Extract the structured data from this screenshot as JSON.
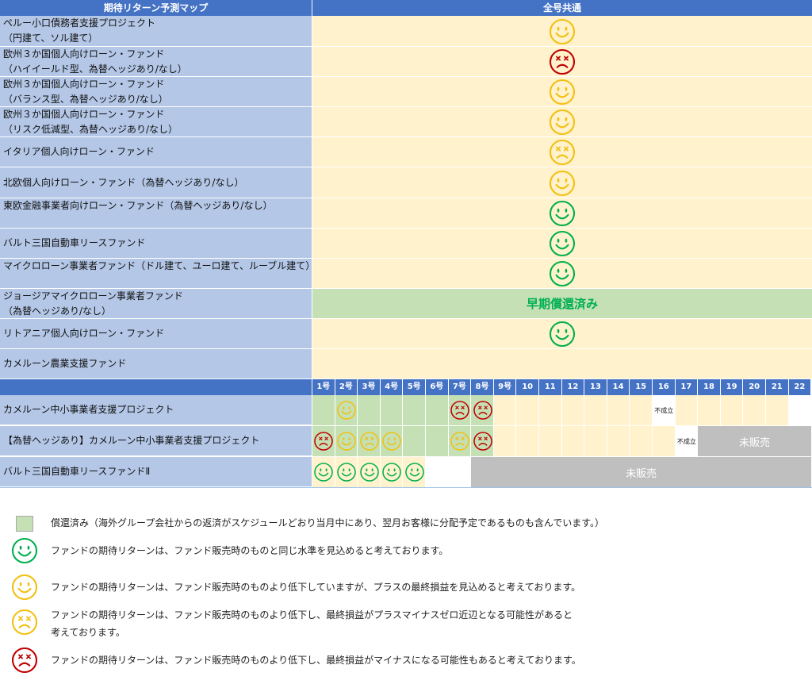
{
  "header": {
    "left": "期待リターン予測マップ",
    "right": "全号共通"
  },
  "funds": [
    {
      "name": "ペルー小口債務者支援プロジェクト\n（円建て、ソル建て）",
      "status": "yellow-smile"
    },
    {
      "name": "欧州３か国個人向けローン・ファンド\n（ハイイールド型、為替ヘッジあり/なし）",
      "status": "red-frown"
    },
    {
      "name": "欧州３か国個人向けローン・ファンド\n（バランス型、為替ヘッジあり/なし）",
      "status": "yellow-smile"
    },
    {
      "name": "欧州３か国個人向けローン・ファンド\n（リスク低減型、為替ヘッジあり/なし）",
      "status": "yellow-smile"
    },
    {
      "name": "イタリア個人向けローン・ファンド",
      "status": "yellow-frown"
    },
    {
      "name": "北欧個人向けローン・ファンド（為替ヘッジあり/なし）",
      "status": "yellow-smile"
    },
    {
      "name": "東欧金融事業者向けローン・ファンド（為替ヘッジあり/なし）",
      "status": "green-smile"
    },
    {
      "name": "バルト三国自動車リースファンド",
      "status": "green-smile"
    },
    {
      "name": "マイクロローン事業者ファンド（ドル建て、ユーロ建て、ルーブル建て）",
      "status": "green-smile"
    },
    {
      "name": "ジョージアマイクロローン事業者ファンド\n（為替ヘッジあり/なし）",
      "status": "redeemed",
      "label": "早期償還済み"
    },
    {
      "name": "リトアニア個人向けローン・ファンド",
      "status": "green-smile"
    },
    {
      "name": "カメルーン農業支援ファンド",
      "status": "blank"
    }
  ],
  "issue_numbers": [
    "1号",
    "2号",
    "3号",
    "4号",
    "5号",
    "6号",
    "7号",
    "8号",
    "9号",
    "10",
    "11",
    "12",
    "13",
    "14",
    "15",
    "16",
    "17",
    "18",
    "19",
    "20",
    "21",
    "22"
  ],
  "series_funds": [
    {
      "name": "カメルーン中小事業者支援プロジェクト",
      "cells": [
        "G",
        "YS",
        "G",
        "G",
        "G",
        "G",
        "RF",
        "RF",
        "C",
        "C",
        "C",
        "C",
        "C",
        "C",
        "C",
        "NOT",
        "C",
        "C",
        "C",
        "C",
        "C",
        "W"
      ]
    },
    {
      "name": "【為替ヘッジあり】カメルーン中小事業者支援プロジェクト",
      "cells": [
        "RF",
        "YS",
        "YF",
        "YS",
        "G",
        "G",
        "YF",
        "RF",
        "C",
        "C",
        "C",
        "C",
        "C",
        "C",
        "C",
        "C",
        "NOT",
        "U",
        "U",
        "U",
        "U",
        "U"
      ]
    },
    {
      "name": "バルト三国自動車リースファンドⅡ",
      "cells": [
        "GS",
        "GS",
        "GS",
        "GS",
        "GS",
        "W",
        "W",
        "U",
        "U",
        "U",
        "U",
        "U",
        "U",
        "U",
        "U",
        "U",
        "U",
        "U",
        "U",
        "U",
        "U",
        "U"
      ]
    }
  ],
  "not_established": "不成立",
  "unsold": "未販売",
  "legend": [
    {
      "icon": "redeemed-swatch",
      "text": "償還済み（海外グループ会社からの返済がスケジュールどおり当月中にあり、翌月お客様に分配予定であるものも含んでいます。）"
    },
    {
      "icon": "green-smile",
      "text": "ファンドの期待リターンは、ファンド販売時のものと同じ水準を見込めると考えております。"
    },
    {
      "icon": "yellow-smile",
      "text": "ファンドの期待リターンは、ファンド販売時のものより低下していますが、プラスの最終損益を見込めると考えております。"
    },
    {
      "icon": "yellow-frown",
      "text": "ファンドの期待リターンは、ファンド販売時のものより低下し、最終損益がプラスマイナスゼロ近辺となる可能性があると\n考えております。"
    },
    {
      "icon": "red-frown",
      "text": "ファンドの期待リターンは、ファンド販売時のものより低下し、最終損益がマイナスになる可能性もあると考えております。"
    }
  ],
  "colors": {
    "header": "#4472c4",
    "name_bg": "#b4c7e7",
    "cream": "#fff2cc",
    "redeemed": "#c5e0b4",
    "unsold": "#bfbfbf",
    "green": "#00b050",
    "yellow": "#f2c012",
    "red": "#c00000"
  }
}
